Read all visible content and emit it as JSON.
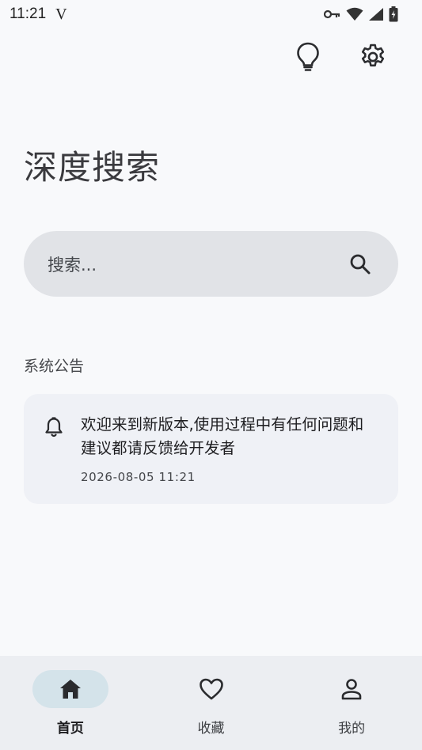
{
  "status_bar": {
    "time": "11:21",
    "carrier_glyph": "V",
    "icons": [
      "key-icon",
      "wifi-icon",
      "signal-icon",
      "battery-charging-icon"
    ]
  },
  "header": {
    "actions": [
      "lightbulb-icon",
      "settings-gear-icon"
    ]
  },
  "page": {
    "title": "深度搜索"
  },
  "search": {
    "placeholder": "搜索...",
    "icon": "search-icon"
  },
  "announcement": {
    "section_title": "系统公告",
    "items": [
      {
        "icon": "bell-icon",
        "message": "欢迎来到新版本,使用过程中有任何问题和建议都请反馈给开发者",
        "timestamp": "2026-08-05 11:21"
      }
    ]
  },
  "bottom_nav": {
    "items": [
      {
        "label": "首页",
        "icon": "home-icon",
        "active": true
      },
      {
        "label": "收藏",
        "icon": "heart-icon",
        "active": false
      },
      {
        "label": "我的",
        "icon": "person-icon",
        "active": false
      }
    ]
  },
  "colors": {
    "background": "#f8f9fb",
    "search_bg": "#e1e3e7",
    "card_bg": "#eff1f6",
    "nav_bg": "#eceef2",
    "active_pill": "#d4e3ea"
  }
}
